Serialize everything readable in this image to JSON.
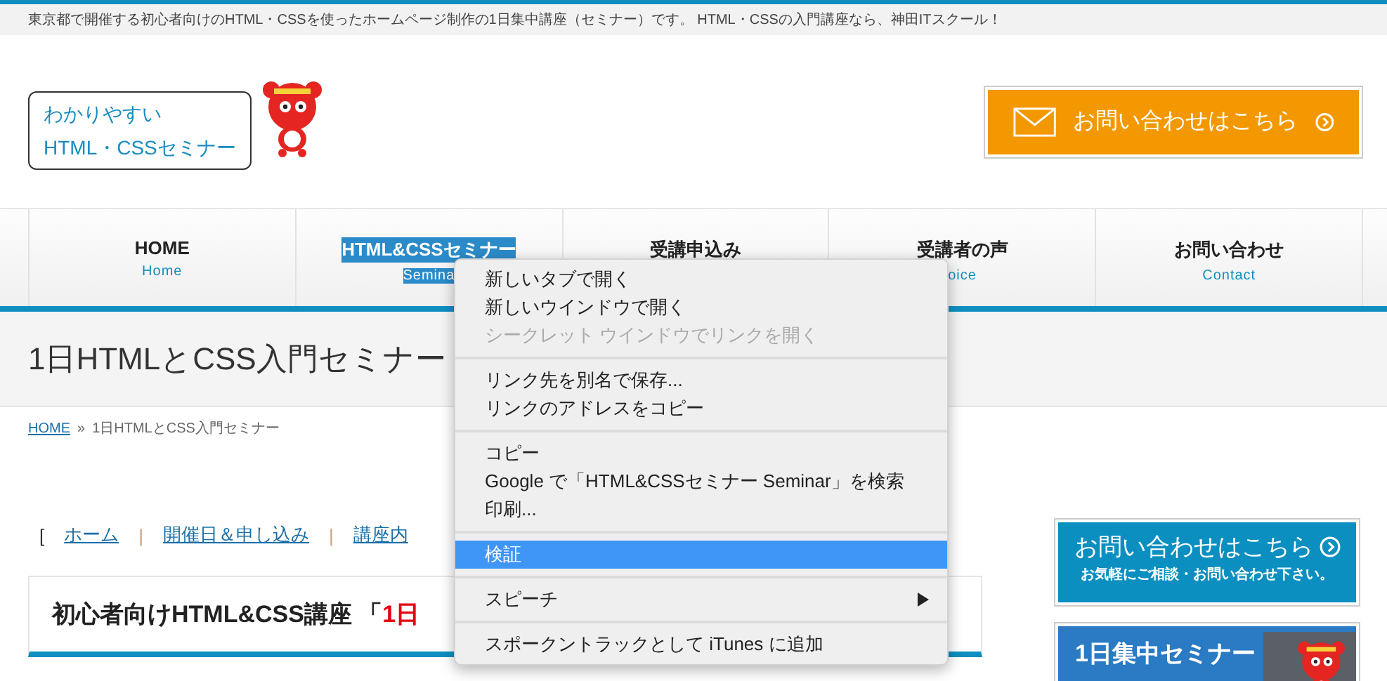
{
  "tagline": "東京都で開催する初心者向けのHTML・CSSを使ったホームページ制作の1日集中講座（セミナー）です。 HTML・CSSの入門講座なら、神田ITスクール！",
  "logo": {
    "lines": [
      "わかりやすい",
      "HTML・CSSセミナー"
    ]
  },
  "contact_button": {
    "label": "お問い合わせはこちら"
  },
  "nav": [
    {
      "title": "HOME",
      "subtitle": "Home",
      "text_selected": false
    },
    {
      "title": "HTML&CSSセミナー",
      "subtitle": "Semina",
      "text_selected": true
    },
    {
      "title": "受講申込み",
      "text_selected": false
    },
    {
      "title": "受講者の声",
      "subtitle": "oice",
      "text_selected": false
    },
    {
      "title": "お問い合わせ",
      "subtitle": "Contact",
      "text_selected": false
    }
  ],
  "page_title": "1日HTMLとCSS入門セミナー",
  "breadcrumb": {
    "home": "HOME",
    "separator": "»",
    "current": "1日HTMLとCSS入門セミナー"
  },
  "link_bar": [
    {
      "kind": "bracket",
      "text": "["
    },
    {
      "kind": "link",
      "text": "ホーム"
    },
    {
      "kind": "separator",
      "text": "|"
    },
    {
      "kind": "link",
      "text": "開催日＆申し込み"
    },
    {
      "kind": "separator",
      "text": "|"
    },
    {
      "kind": "link",
      "text": "講座内"
    }
  ],
  "section_heading": [
    {
      "text": "初心者向けHTML&CSS講座 「",
      "accent": false
    },
    {
      "text": "1日",
      "accent": true
    }
  ],
  "sidebar": {
    "contact_banner": {
      "title": "お問い合わせはこちら",
      "subtitle": "お気軽にご相談・お問い合わせ下さい。"
    },
    "seminar_banner": {
      "title": "1日集中セミナー"
    }
  },
  "context_menu": [
    [
      {
        "label": "新しいタブで開く",
        "disabled": false,
        "selected": false,
        "submenu": false
      },
      {
        "label": "新しいウインドウで開く",
        "disabled": false,
        "selected": false,
        "submenu": false
      },
      {
        "label": "シークレット ウインドウでリンクを開く",
        "disabled": true,
        "selected": false,
        "submenu": false
      }
    ],
    [
      {
        "label": "リンク先を別名で保存...",
        "disabled": false,
        "selected": false,
        "submenu": false
      },
      {
        "label": "リンクのアドレスをコピー",
        "disabled": false,
        "selected": false,
        "submenu": false
      }
    ],
    [
      {
        "label": "コピー",
        "disabled": false,
        "selected": false,
        "submenu": false
      },
      {
        "label": "Google で「HTML&CSSセミナー Seminar」を検索",
        "disabled": false,
        "selected": false,
        "submenu": false
      },
      {
        "label": "印刷...",
        "disabled": false,
        "selected": false,
        "submenu": false
      }
    ],
    [
      {
        "label": "検証",
        "disabled": false,
        "selected": true,
        "submenu": false
      }
    ],
    [
      {
        "label": "スピーチ",
        "disabled": false,
        "selected": false,
        "submenu": true
      }
    ],
    [
      {
        "label": "スポークントラックとして iTunes に追加",
        "disabled": false,
        "selected": false,
        "submenu": false
      }
    ]
  ]
}
